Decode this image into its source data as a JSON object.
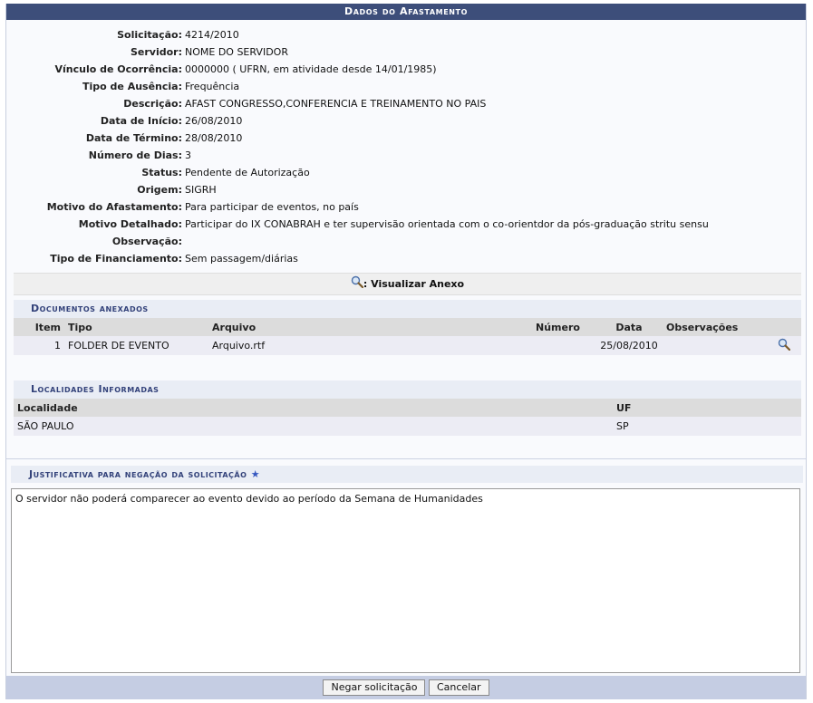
{
  "header": {
    "title": "Dados do Afastamento"
  },
  "fields": [
    {
      "label": "Solicitação:",
      "value": "4214/2010"
    },
    {
      "label": "Servidor:",
      "value": "NOME DO SERVIDOR"
    },
    {
      "label": "Vínculo de Ocorrência:",
      "value": "0000000 ( UFRN, em atividade desde 14/01/1985)"
    },
    {
      "label": "Tipo de Ausência:",
      "value": "Frequência"
    },
    {
      "label": "Descrição:",
      "value": "AFAST CONGRESSO,CONFERENCIA E TREINAMENTO NO PAIS"
    },
    {
      "label": "Data de Início:",
      "value": "26/08/2010"
    },
    {
      "label": "Data de Término:",
      "value": "28/08/2010"
    },
    {
      "label": "Número de Dias:",
      "value": "3"
    },
    {
      "label": "Status:",
      "value": "Pendente de Autorização"
    },
    {
      "label": "Origem:",
      "value": "SIGRH"
    },
    {
      "label": "Motivo do Afastamento:",
      "value": "Para participar de eventos, no país"
    },
    {
      "label": "Motivo Detalhado:",
      "value": "Participar do IX CONABRAH e ter supervisão orientada com o co-orientdor da pós-graduação stritu sensu"
    },
    {
      "label": "Observação:",
      "value": ""
    },
    {
      "label": "Tipo de Financiamento:",
      "value": "Sem passagem/diárias"
    }
  ],
  "view_attachment": {
    "label": ": Visualizar Anexo",
    "icon": "magnifier-icon"
  },
  "documents": {
    "title": "Documentos anexados",
    "columns": [
      "Item",
      "Tipo",
      "Arquivo",
      "Número",
      "Data",
      "Observações"
    ],
    "rows": [
      {
        "item": "1",
        "tipo": "FOLDER DE EVENTO",
        "arquivo": "Arquivo.rtf",
        "numero": "",
        "data": "25/08/2010",
        "observacoes": ""
      }
    ]
  },
  "localities": {
    "title": "Localidades Informadas",
    "columns": [
      "Localidade",
      "UF"
    ],
    "rows": [
      {
        "localidade": "SÃO PAULO",
        "uf": "SP"
      }
    ]
  },
  "justification": {
    "title": "Justificativa para negação da solicitação",
    "required_marker": "★",
    "value": "O servidor não poderá comparecer ao evento devido ao período da Semana de Humanidades"
  },
  "buttons": {
    "deny": "Negar solicitação",
    "cancel": "Cancelar"
  },
  "colors": {
    "header_bg": "#3d4e7a",
    "section_title": "#33427a",
    "footer_bg": "#c5cde3"
  }
}
